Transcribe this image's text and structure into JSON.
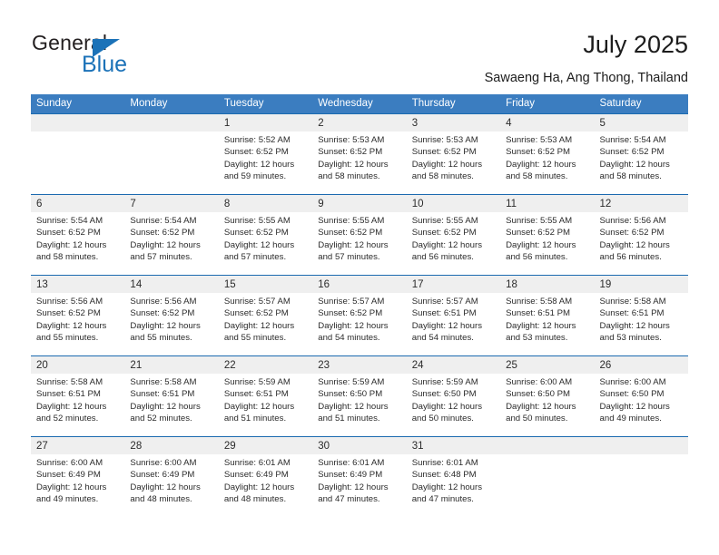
{
  "brand": {
    "name_part1": "General",
    "name_part2": "Blue",
    "triangle_color": "#1b72b8"
  },
  "header": {
    "title": "July 2025",
    "subtitle": "Sawaeng Ha, Ang Thong, Thailand",
    "accent_color": "#3b7dc0",
    "row_divider_color": "#1b6ab0",
    "day_band_color": "#efefef"
  },
  "weekdays": [
    "Sunday",
    "Monday",
    "Tuesday",
    "Wednesday",
    "Thursday",
    "Friday",
    "Saturday"
  ],
  "weeks": [
    [
      {
        "day": "",
        "sunrise": "",
        "sunset": "",
        "daylight_line1": "",
        "daylight_line2": ""
      },
      {
        "day": "",
        "sunrise": "",
        "sunset": "",
        "daylight_line1": "",
        "daylight_line2": ""
      },
      {
        "day": "1",
        "sunrise": "Sunrise: 5:52 AM",
        "sunset": "Sunset: 6:52 PM",
        "daylight_line1": "Daylight: 12 hours",
        "daylight_line2": "and 59 minutes."
      },
      {
        "day": "2",
        "sunrise": "Sunrise: 5:53 AM",
        "sunset": "Sunset: 6:52 PM",
        "daylight_line1": "Daylight: 12 hours",
        "daylight_line2": "and 58 minutes."
      },
      {
        "day": "3",
        "sunrise": "Sunrise: 5:53 AM",
        "sunset": "Sunset: 6:52 PM",
        "daylight_line1": "Daylight: 12 hours",
        "daylight_line2": "and 58 minutes."
      },
      {
        "day": "4",
        "sunrise": "Sunrise: 5:53 AM",
        "sunset": "Sunset: 6:52 PM",
        "daylight_line1": "Daylight: 12 hours",
        "daylight_line2": "and 58 minutes."
      },
      {
        "day": "5",
        "sunrise": "Sunrise: 5:54 AM",
        "sunset": "Sunset: 6:52 PM",
        "daylight_line1": "Daylight: 12 hours",
        "daylight_line2": "and 58 minutes."
      }
    ],
    [
      {
        "day": "6",
        "sunrise": "Sunrise: 5:54 AM",
        "sunset": "Sunset: 6:52 PM",
        "daylight_line1": "Daylight: 12 hours",
        "daylight_line2": "and 58 minutes."
      },
      {
        "day": "7",
        "sunrise": "Sunrise: 5:54 AM",
        "sunset": "Sunset: 6:52 PM",
        "daylight_line1": "Daylight: 12 hours",
        "daylight_line2": "and 57 minutes."
      },
      {
        "day": "8",
        "sunrise": "Sunrise: 5:55 AM",
        "sunset": "Sunset: 6:52 PM",
        "daylight_line1": "Daylight: 12 hours",
        "daylight_line2": "and 57 minutes."
      },
      {
        "day": "9",
        "sunrise": "Sunrise: 5:55 AM",
        "sunset": "Sunset: 6:52 PM",
        "daylight_line1": "Daylight: 12 hours",
        "daylight_line2": "and 57 minutes."
      },
      {
        "day": "10",
        "sunrise": "Sunrise: 5:55 AM",
        "sunset": "Sunset: 6:52 PM",
        "daylight_line1": "Daylight: 12 hours",
        "daylight_line2": "and 56 minutes."
      },
      {
        "day": "11",
        "sunrise": "Sunrise: 5:55 AM",
        "sunset": "Sunset: 6:52 PM",
        "daylight_line1": "Daylight: 12 hours",
        "daylight_line2": "and 56 minutes."
      },
      {
        "day": "12",
        "sunrise": "Sunrise: 5:56 AM",
        "sunset": "Sunset: 6:52 PM",
        "daylight_line1": "Daylight: 12 hours",
        "daylight_line2": "and 56 minutes."
      }
    ],
    [
      {
        "day": "13",
        "sunrise": "Sunrise: 5:56 AM",
        "sunset": "Sunset: 6:52 PM",
        "daylight_line1": "Daylight: 12 hours",
        "daylight_line2": "and 55 minutes."
      },
      {
        "day": "14",
        "sunrise": "Sunrise: 5:56 AM",
        "sunset": "Sunset: 6:52 PM",
        "daylight_line1": "Daylight: 12 hours",
        "daylight_line2": "and 55 minutes."
      },
      {
        "day": "15",
        "sunrise": "Sunrise: 5:57 AM",
        "sunset": "Sunset: 6:52 PM",
        "daylight_line1": "Daylight: 12 hours",
        "daylight_line2": "and 55 minutes."
      },
      {
        "day": "16",
        "sunrise": "Sunrise: 5:57 AM",
        "sunset": "Sunset: 6:52 PM",
        "daylight_line1": "Daylight: 12 hours",
        "daylight_line2": "and 54 minutes."
      },
      {
        "day": "17",
        "sunrise": "Sunrise: 5:57 AM",
        "sunset": "Sunset: 6:51 PM",
        "daylight_line1": "Daylight: 12 hours",
        "daylight_line2": "and 54 minutes."
      },
      {
        "day": "18",
        "sunrise": "Sunrise: 5:58 AM",
        "sunset": "Sunset: 6:51 PM",
        "daylight_line1": "Daylight: 12 hours",
        "daylight_line2": "and 53 minutes."
      },
      {
        "day": "19",
        "sunrise": "Sunrise: 5:58 AM",
        "sunset": "Sunset: 6:51 PM",
        "daylight_line1": "Daylight: 12 hours",
        "daylight_line2": "and 53 minutes."
      }
    ],
    [
      {
        "day": "20",
        "sunrise": "Sunrise: 5:58 AM",
        "sunset": "Sunset: 6:51 PM",
        "daylight_line1": "Daylight: 12 hours",
        "daylight_line2": "and 52 minutes."
      },
      {
        "day": "21",
        "sunrise": "Sunrise: 5:58 AM",
        "sunset": "Sunset: 6:51 PM",
        "daylight_line1": "Daylight: 12 hours",
        "daylight_line2": "and 52 minutes."
      },
      {
        "day": "22",
        "sunrise": "Sunrise: 5:59 AM",
        "sunset": "Sunset: 6:51 PM",
        "daylight_line1": "Daylight: 12 hours",
        "daylight_line2": "and 51 minutes."
      },
      {
        "day": "23",
        "sunrise": "Sunrise: 5:59 AM",
        "sunset": "Sunset: 6:50 PM",
        "daylight_line1": "Daylight: 12 hours",
        "daylight_line2": "and 51 minutes."
      },
      {
        "day": "24",
        "sunrise": "Sunrise: 5:59 AM",
        "sunset": "Sunset: 6:50 PM",
        "daylight_line1": "Daylight: 12 hours",
        "daylight_line2": "and 50 minutes."
      },
      {
        "day": "25",
        "sunrise": "Sunrise: 6:00 AM",
        "sunset": "Sunset: 6:50 PM",
        "daylight_line1": "Daylight: 12 hours",
        "daylight_line2": "and 50 minutes."
      },
      {
        "day": "26",
        "sunrise": "Sunrise: 6:00 AM",
        "sunset": "Sunset: 6:50 PM",
        "daylight_line1": "Daylight: 12 hours",
        "daylight_line2": "and 49 minutes."
      }
    ],
    [
      {
        "day": "27",
        "sunrise": "Sunrise: 6:00 AM",
        "sunset": "Sunset: 6:49 PM",
        "daylight_line1": "Daylight: 12 hours",
        "daylight_line2": "and 49 minutes."
      },
      {
        "day": "28",
        "sunrise": "Sunrise: 6:00 AM",
        "sunset": "Sunset: 6:49 PM",
        "daylight_line1": "Daylight: 12 hours",
        "daylight_line2": "and 48 minutes."
      },
      {
        "day": "29",
        "sunrise": "Sunrise: 6:01 AM",
        "sunset": "Sunset: 6:49 PM",
        "daylight_line1": "Daylight: 12 hours",
        "daylight_line2": "and 48 minutes."
      },
      {
        "day": "30",
        "sunrise": "Sunrise: 6:01 AM",
        "sunset": "Sunset: 6:49 PM",
        "daylight_line1": "Daylight: 12 hours",
        "daylight_line2": "and 47 minutes."
      },
      {
        "day": "31",
        "sunrise": "Sunrise: 6:01 AM",
        "sunset": "Sunset: 6:48 PM",
        "daylight_line1": "Daylight: 12 hours",
        "daylight_line2": "and 47 minutes."
      },
      {
        "day": "",
        "sunrise": "",
        "sunset": "",
        "daylight_line1": "",
        "daylight_line2": ""
      },
      {
        "day": "",
        "sunrise": "",
        "sunset": "",
        "daylight_line1": "",
        "daylight_line2": ""
      }
    ]
  ]
}
